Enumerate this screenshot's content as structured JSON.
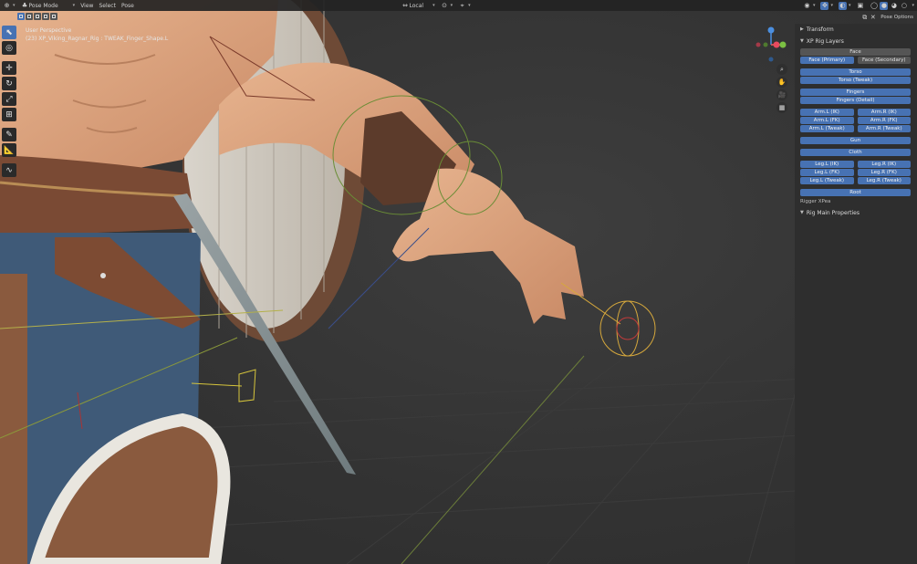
{
  "header": {
    "editor_icon": "viewport-icon",
    "mode": "Pose Mode",
    "menus": [
      "View",
      "Select",
      "Pose"
    ],
    "transform_orientation": "Local",
    "pose_options": "Pose Options"
  },
  "viewport": {
    "perspective": "User Perspective",
    "object_info": "(23) XP_Viking_Ragnar_Rig : TWEAK_Finger_Shape.L"
  },
  "gizmo": {
    "axes": [
      "X",
      "Y",
      "Z"
    ],
    "colors": {
      "x": "#e84a5f",
      "y": "#7bc043",
      "z": "#4b8fe0"
    }
  },
  "sidebar": {
    "transform_label": "Transform",
    "rig_layers_label": "XP Rig Layers",
    "rows": [
      {
        "buttons": [
          {
            "label": "Face",
            "on": false
          }
        ],
        "gap": false
      },
      {
        "buttons": [
          {
            "label": "Face (Primary)",
            "on": true
          },
          {
            "label": "Face (Secondary)",
            "on": false
          }
        ],
        "gap": false
      },
      {
        "buttons": [
          {
            "label": "Torso",
            "on": true
          }
        ],
        "gap": true
      },
      {
        "buttons": [
          {
            "label": "Torso (Tweak)",
            "on": true
          }
        ],
        "gap": false
      },
      {
        "buttons": [
          {
            "label": "Fingers",
            "on": true
          }
        ],
        "gap": true
      },
      {
        "buttons": [
          {
            "label": "Fingers (Detail)",
            "on": true
          }
        ],
        "gap": false
      },
      {
        "buttons": [
          {
            "label": "Arm.L (IK)",
            "on": true
          },
          {
            "label": "Arm.R (IK)",
            "on": true
          }
        ],
        "gap": true
      },
      {
        "buttons": [
          {
            "label": "Arm.L (FK)",
            "on": true
          },
          {
            "label": "Arm.R (FK)",
            "on": true
          }
        ],
        "gap": false
      },
      {
        "buttons": [
          {
            "label": "Arm.L (Tweak)",
            "on": true
          },
          {
            "label": "Arm.R (Tweak)",
            "on": true
          }
        ],
        "gap": false
      },
      {
        "buttons": [
          {
            "label": "Gun",
            "on": true
          }
        ],
        "gap": true
      },
      {
        "buttons": [
          {
            "label": "Cloth",
            "on": true
          }
        ],
        "gap": true
      },
      {
        "buttons": [
          {
            "label": "Leg.L (IK)",
            "on": true
          },
          {
            "label": "Leg.R (IK)",
            "on": true
          }
        ],
        "gap": true
      },
      {
        "buttons": [
          {
            "label": "Leg.L (FK)",
            "on": true
          },
          {
            "label": "Leg.R (FK)",
            "on": true
          }
        ],
        "gap": false
      },
      {
        "buttons": [
          {
            "label": "Leg.L (Tweak)",
            "on": true
          },
          {
            "label": "Leg.R (Tweak)",
            "on": true
          }
        ],
        "gap": false
      },
      {
        "buttons": [
          {
            "label": "Root",
            "on": true
          }
        ],
        "gap": true
      }
    ],
    "credit": "Rigger XPea",
    "main_props_label": "Rig Main Properties"
  },
  "toolbar": {
    "tools": [
      "select-box-icon",
      "cursor-icon",
      "move-icon",
      "rotate-icon",
      "scale-icon",
      "transform-icon",
      "annotate-icon",
      "measure-icon",
      "relax-pose-icon"
    ]
  }
}
